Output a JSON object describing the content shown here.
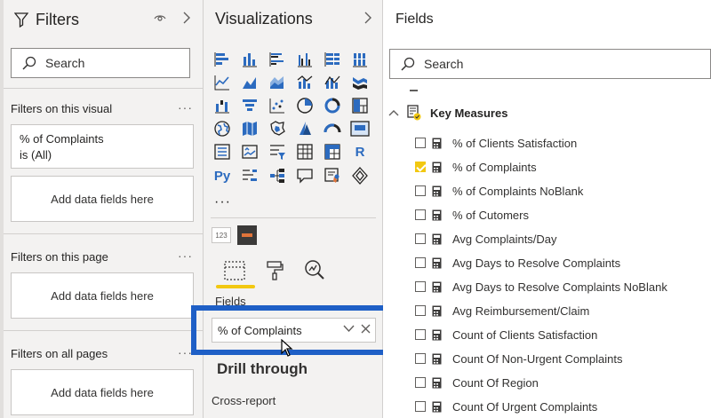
{
  "filters": {
    "title": "Filters",
    "search_placeholder": "Search",
    "this_visual_label": "Filters on this visual",
    "filter_card": {
      "name": "% of Complaints",
      "state": "is (All)"
    },
    "add_data_label": "Add data fields here",
    "this_page_label": "Filters on this page",
    "all_pages_label": "Filters on all pages",
    "more": "···"
  },
  "visualizations": {
    "title": "Visualizations",
    "icons": [
      "stacked-bar-icon",
      "stacked-column-icon",
      "clustered-bar-icon",
      "clustered-column-icon",
      "100-stacked-bar-icon",
      "100-stacked-column-icon",
      "line-chart-icon",
      "area-chart-icon",
      "stacked-area-icon",
      "line-clustered-column-icon",
      "line-stacked-column-icon",
      "ribbon-chart-icon",
      "waterfall-icon",
      "funnel-icon",
      "scatter-icon",
      "pie-chart-icon",
      "donut-chart-icon",
      "treemap-icon",
      "map-icon",
      "filled-map-icon",
      "shape-map-icon",
      "azure-map-icon",
      "gauge-icon",
      "card-icon",
      "multi-row-card-icon",
      "kpi-icon",
      "slicer-icon",
      "table-icon",
      "matrix-icon",
      "r-visual-icon",
      "python-visual-icon",
      "key-influencers-icon",
      "decomposition-tree-icon",
      "qa-icon",
      "smart-narrative-icon",
      "paginated-report-icon"
    ],
    "r_label": "R",
    "py_label": "Py",
    "more": "···",
    "custom_123": "123",
    "fields_label": "Fields",
    "field_value": "% of Complaints",
    "drill_through": "Drill through",
    "cross_report": "Cross-report"
  },
  "fields_pane": {
    "title": "Fields",
    "search_placeholder": "Search",
    "group": "Key Measures",
    "items": [
      {
        "label": "% of Clients Satisfaction",
        "checked": false
      },
      {
        "label": "% of Complaints",
        "checked": true
      },
      {
        "label": "% of Complaints NoBlank",
        "checked": false
      },
      {
        "label": "% of Cutomers",
        "checked": false
      },
      {
        "label": "Avg Complaints/Day",
        "checked": false
      },
      {
        "label": "Avg Days to Resolve Complaints",
        "checked": false
      },
      {
        "label": "Avg Days to Resolve Complaints NoBlank",
        "checked": false
      },
      {
        "label": "Avg Reimbursement/Claim",
        "checked": false
      },
      {
        "label": "Count of Clients Satisfaction",
        "checked": false
      },
      {
        "label": "Count Of Non-Urgent Complaints",
        "checked": false
      },
      {
        "label": "Count Of Region",
        "checked": false
      },
      {
        "label": "Count Of Urgent Complaints",
        "checked": false
      }
    ]
  },
  "colors": {
    "accent_yellow": "#f2c811",
    "highlight_blue": "#1e5fc6",
    "viz_blue": "#2c6bbf"
  }
}
